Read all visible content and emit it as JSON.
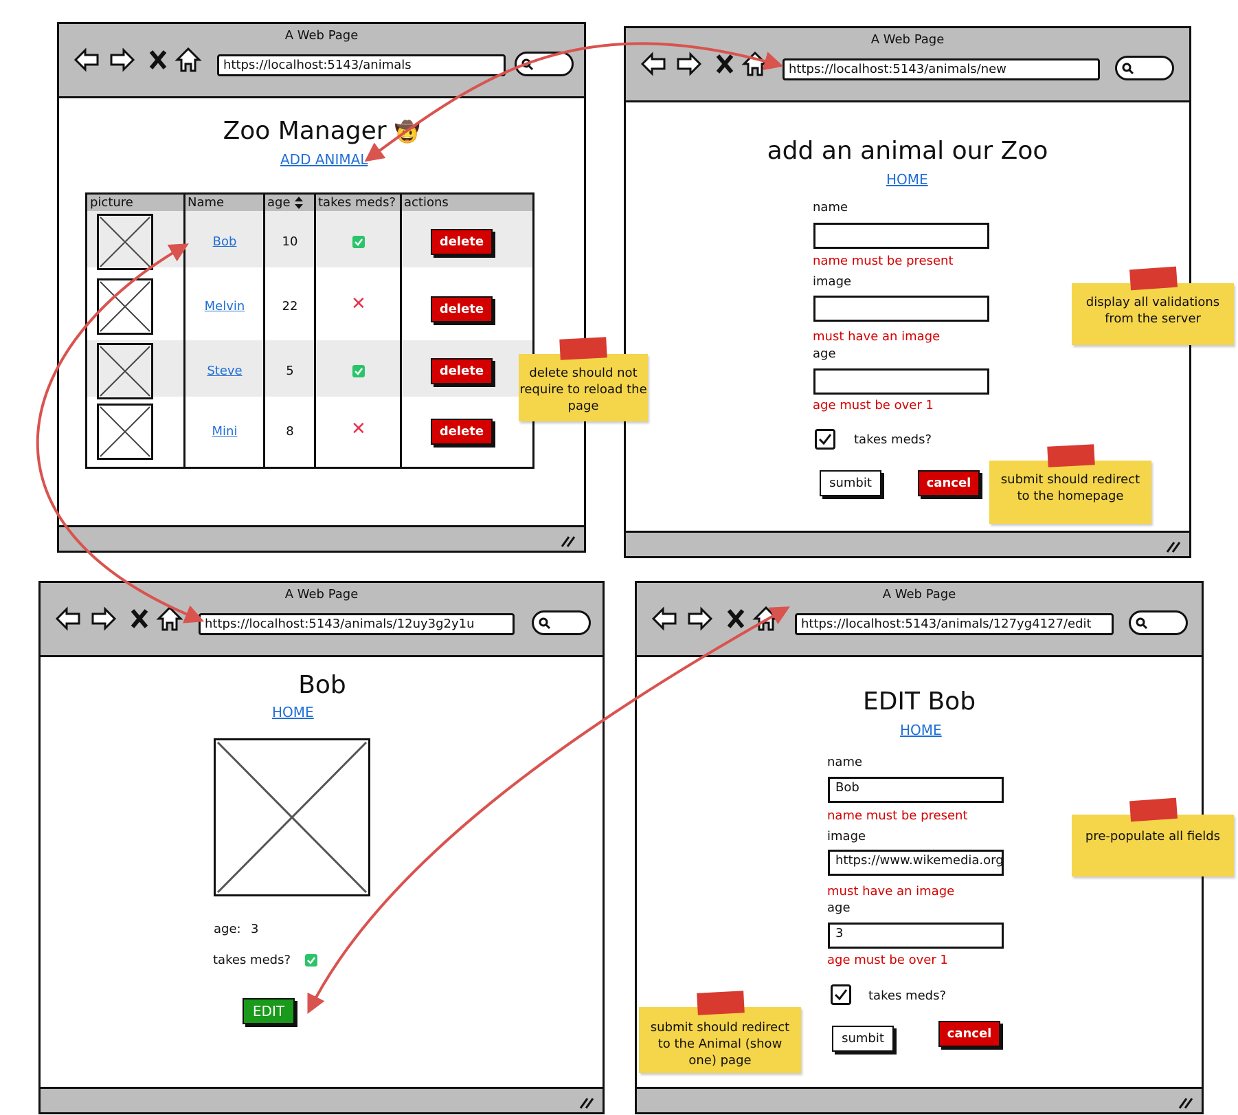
{
  "window_title": "A Web Page",
  "windows": {
    "list": {
      "url": "https://localhost:5143/animals",
      "heading": "Zoo Manager",
      "emoji": "🤠",
      "add_link": "ADD ANIMAL",
      "columns": [
        "picture",
        "Name",
        "age",
        "takes meds?",
        "actions"
      ],
      "rows": [
        {
          "name": "Bob",
          "age": "10",
          "meds": true,
          "action": "delete"
        },
        {
          "name": "Melvin",
          "age": "22",
          "meds": false,
          "action": "delete"
        },
        {
          "name": "Steve",
          "age": "5",
          "meds": true,
          "action": "delete"
        },
        {
          "name": "Mini",
          "age": "8",
          "meds": false,
          "action": "delete"
        }
      ]
    },
    "new": {
      "url": "https://localhost:5143/animals/new",
      "heading": "add an animal our Zoo",
      "home_link": "HOME",
      "name_label": "name",
      "name_value": "",
      "name_error": "name must be present",
      "image_label": "image",
      "image_value": "",
      "image_error": "must have an image",
      "age_label": "age",
      "age_value": "",
      "age_error": "age must be over 1",
      "meds_label": "takes meds?",
      "meds_checked": true,
      "submit_label": "sumbit",
      "cancel_label": "cancel"
    },
    "show": {
      "url": "https://localhost:5143/animals/12uy3g2y1u",
      "heading": "Bob",
      "home_link": "HOME",
      "age_label": "age:",
      "age_value": "3",
      "meds_label": "takes meds?",
      "meds_checked": true,
      "edit_label": "EDIT"
    },
    "edit": {
      "url": "https://localhost:5143/animals/127yg4127/edit",
      "heading": "EDIT Bob",
      "home_link": "HOME",
      "name_label": "name",
      "name_value": "Bob",
      "name_error": "name must be present",
      "image_label": "image",
      "image_value": "https://www.wikemedia.org",
      "image_error": "must have an image",
      "age_label": "age",
      "age_value": "3",
      "age_error": "age must be over 1",
      "meds_label": "takes meds?",
      "meds_checked": true,
      "submit_label": "sumbit",
      "cancel_label": "cancel"
    }
  },
  "notes": {
    "delete": "delete should not require to reload the page",
    "validations": "display all validations from the server",
    "submit_home": "submit should redirect to the homepage",
    "prepopulate": "pre-populate all fields",
    "submit_show": "submit should redirect to the Animal (show one) page"
  },
  "colors": {
    "link": "#1f6fd6",
    "error": "#d40000",
    "delete_button": "#d40000",
    "edit_button": "#1a9a1a",
    "sticky_note": "#f5d54a",
    "arrow": "#d9534f",
    "chrome": "#bdbdbd"
  },
  "icons": [
    "back-arrow-icon",
    "forward-arrow-icon",
    "close-icon",
    "home-icon",
    "search-icon",
    "resize-grip-icon",
    "sort-icon",
    "check-icon",
    "cross-icon",
    "image-placeholder-icon",
    "checkbox-icon"
  ]
}
